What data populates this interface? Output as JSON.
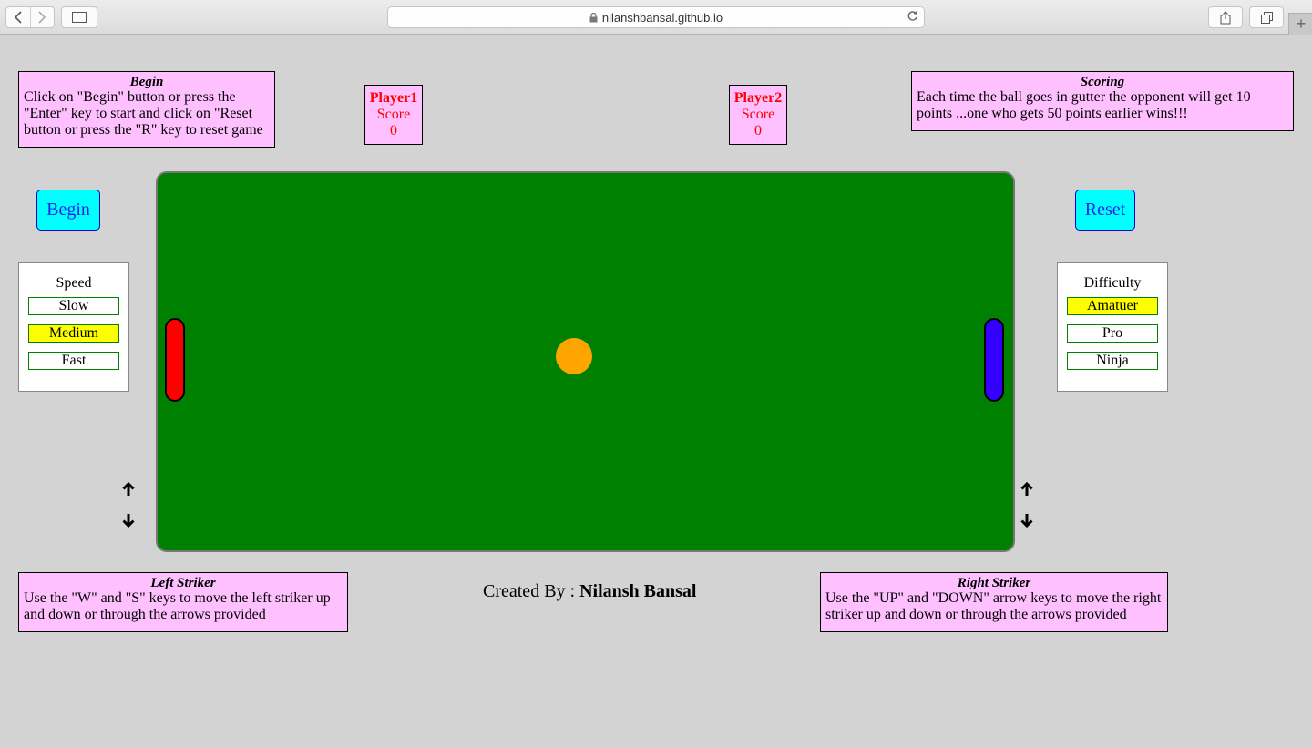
{
  "browser": {
    "url": "nilanshbansal.github.io",
    "new_tab_label": "+"
  },
  "info": {
    "begin": {
      "title": "Begin",
      "text": "Click on \"Begin\" button or press the \"Enter\" key to start and click on \"Reset button or press the \"R\" key to reset game"
    },
    "scoring": {
      "title": "Scoring",
      "text": "Each time the ball goes in gutter the opponent will get 10 points ...one who gets 50 points earlier wins!!!"
    },
    "left_striker": {
      "title": "Left Striker",
      "text": "Use the \"W\" and \"S\" keys to move the left striker up and down or through the arrows provided"
    },
    "right_striker": {
      "title": "Right Striker",
      "text": "Use the \"UP\" and \"DOWN\" arrow keys to move the right striker up and down or through the arrows provided"
    }
  },
  "players": [
    {
      "name": "Player1",
      "score_label": "Score",
      "score": "0"
    },
    {
      "name": "Player2",
      "score_label": "Score",
      "score": "0"
    }
  ],
  "buttons": {
    "begin": "Begin",
    "reset": "Reset"
  },
  "speed": {
    "title": "Speed",
    "options": [
      "Slow",
      "Medium",
      "Fast"
    ],
    "selected": "Medium"
  },
  "difficulty": {
    "title": "Difficulty",
    "options": [
      "Amatuer",
      "Pro",
      "Ninja"
    ],
    "selected": "Amatuer"
  },
  "credit": {
    "prefix": "Created By :",
    "name": "Nilansh Bansal"
  },
  "colors": {
    "field": "#008000",
    "left_striker": "#ff0000",
    "right_striker": "#3300ff",
    "ball": "#ffa500",
    "info_bg": "#ffc0ff",
    "selected_option": "#ffff00",
    "button_bg": "#00ffff"
  },
  "icons": [
    "back-icon",
    "forward-icon",
    "sidebar-icon",
    "lock-icon",
    "reload-icon",
    "share-icon",
    "tabs-icon",
    "arrow-up-icon",
    "arrow-down-icon"
  ]
}
